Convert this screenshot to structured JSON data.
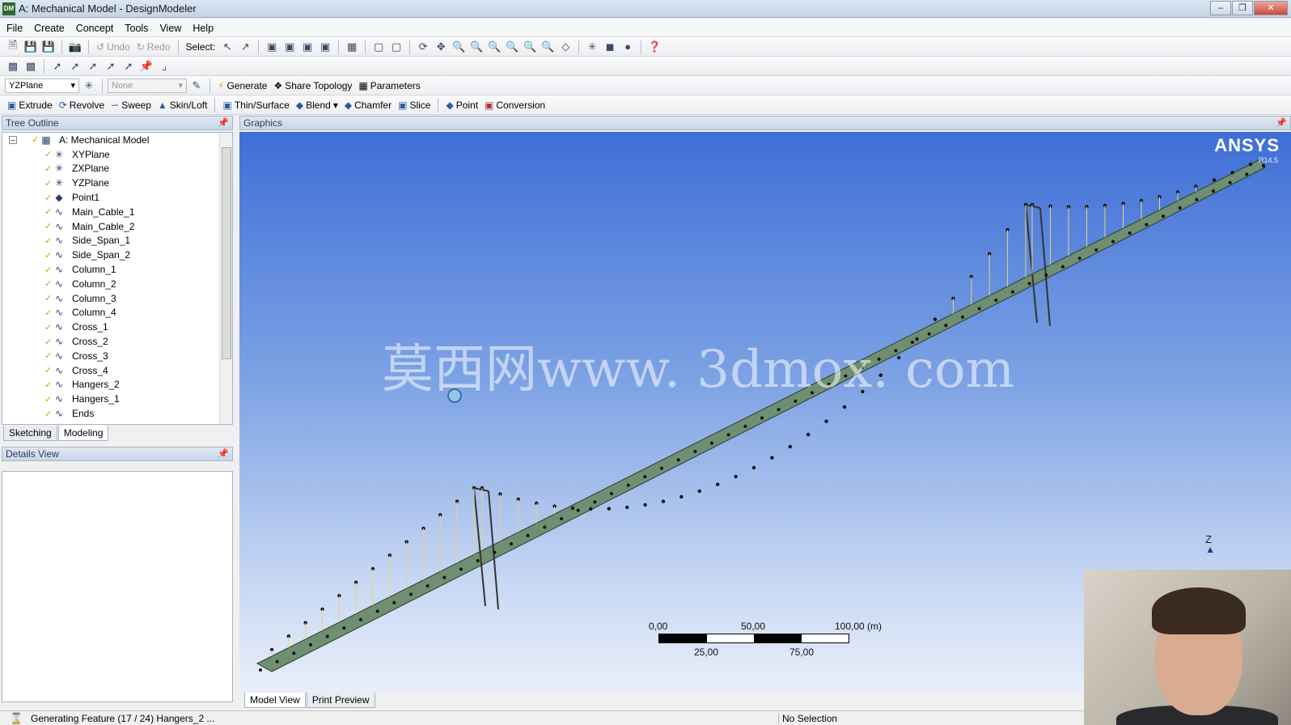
{
  "window": {
    "title": "A: Mechanical Model - DesignModeler",
    "app_icon": "DM"
  },
  "menu": [
    "File",
    "Create",
    "Concept",
    "Tools",
    "View",
    "Help"
  ],
  "toolbar1": {
    "select_label": "Select:",
    "undo_label": "Undo",
    "redo_label": "Redo"
  },
  "toolbar3": {
    "plane_value": "YZPlane",
    "sketch_value": "None",
    "generate_label": "Generate",
    "share_topology_label": "Share Topology",
    "parameters_label": "Parameters"
  },
  "toolbar4": {
    "extrude": "Extrude",
    "revolve": "Revolve",
    "sweep": "Sweep",
    "skin_loft": "Skin/Loft",
    "thin_surface": "Thin/Surface",
    "blend": "Blend",
    "chamfer": "Chamfer",
    "slice": "Slice",
    "point": "Point",
    "conversion": "Conversion"
  },
  "tree_outline": {
    "title": "Tree Outline",
    "root": "A: Mechanical Model",
    "items": [
      {
        "label": "XYPlane",
        "icon": "plane-icon"
      },
      {
        "label": "ZXPlane",
        "icon": "plane-icon"
      },
      {
        "label": "YZPlane",
        "icon": "plane-icon"
      },
      {
        "label": "Point1",
        "icon": "point-feature-icon"
      },
      {
        "label": "Main_Cable_1",
        "icon": "line-body-icon"
      },
      {
        "label": "Main_Cable_2",
        "icon": "line-body-icon"
      },
      {
        "label": "Side_Span_1",
        "icon": "line-body-icon"
      },
      {
        "label": "Side_Span_2",
        "icon": "line-body-icon"
      },
      {
        "label": "Column_1",
        "icon": "line-body-icon"
      },
      {
        "label": "Column_2",
        "icon": "line-body-icon"
      },
      {
        "label": "Column_3",
        "icon": "line-body-icon"
      },
      {
        "label": "Column_4",
        "icon": "line-body-icon"
      },
      {
        "label": "Cross_1",
        "icon": "line-body-icon"
      },
      {
        "label": "Cross_2",
        "icon": "line-body-icon"
      },
      {
        "label": "Cross_3",
        "icon": "line-body-icon"
      },
      {
        "label": "Cross_4",
        "icon": "line-body-icon"
      },
      {
        "label": "Hangers_2",
        "icon": "line-body-icon"
      },
      {
        "label": "Hangers_1",
        "icon": "line-body-icon"
      },
      {
        "label": "Ends",
        "icon": "line-body-icon"
      }
    ],
    "tabs": [
      "Sketching",
      "Modeling"
    ]
  },
  "details_view": {
    "title": "Details View"
  },
  "graphics": {
    "title": "Graphics",
    "logo": "ANSYS",
    "logo_version": "R14.5",
    "watermark": "莫西网www. 3dmox. com",
    "axis_label": "Z",
    "scale": {
      "top_labels": [
        "0,00",
        "50,00",
        "100,00 (m)"
      ],
      "bottom_labels": [
        "25,00",
        "75,00"
      ]
    },
    "colors": {
      "bg_top": "#3f6fd6",
      "bg_bottom": "#e9eff9",
      "deck": "#6f8f72"
    }
  },
  "view_tabs": [
    "Model View",
    "Print Preview"
  ],
  "status": {
    "message": "Generating Feature (17 / 24) Hangers_2 ...",
    "selection": "No Selection"
  }
}
